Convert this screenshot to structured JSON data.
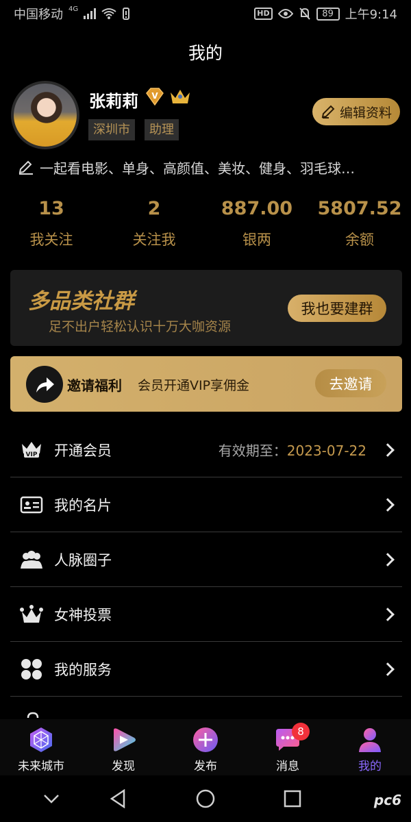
{
  "status_bar": {
    "carrier": "中国移动",
    "network": "4G",
    "hd": "HD",
    "battery": "89",
    "time": "上午9:14"
  },
  "header": {
    "title": "我的"
  },
  "profile": {
    "name": "张莉莉",
    "vip_badge": "V",
    "tags": [
      "深圳市",
      "助理"
    ],
    "edit_label": "编辑资料",
    "bio": "一起看电影、单身、高颜值、美妆、健身、羽毛球…"
  },
  "stats": [
    {
      "value": "13",
      "label": "我关注"
    },
    {
      "value": "2",
      "label": "关注我"
    },
    {
      "value": "887.00",
      "label": "银两"
    },
    {
      "value": "5807.52",
      "label": "余额"
    }
  ],
  "community": {
    "title": "多品类社群",
    "subtitle": "足不出户轻松认识十万大咖资源",
    "button": "我也要建群"
  },
  "invite": {
    "title": "邀请福利",
    "desc": "会员开通VIP享佣金",
    "button": "去邀请"
  },
  "menu": [
    {
      "label": "开通会员",
      "icon": "vip-crown-icon",
      "right_key": "有效期至：",
      "right_value": "2023-07-22"
    },
    {
      "label": "我的名片",
      "icon": "id-card-icon"
    },
    {
      "label": "人脉圈子",
      "icon": "people-icon"
    },
    {
      "label": "女神投票",
      "icon": "crown-icon"
    },
    {
      "label": "我的服务",
      "icon": "grid-clover-icon"
    }
  ],
  "tabs": [
    {
      "label": "未来城市",
      "icon": "polyhedron-icon"
    },
    {
      "label": "发现",
      "icon": "play-icon"
    },
    {
      "label": "发布",
      "icon": "plus-circle-icon"
    },
    {
      "label": "消息",
      "icon": "chat-icon",
      "badge": "8"
    },
    {
      "label": "我的",
      "icon": "person-icon",
      "active": true
    }
  ],
  "watermark": "pc6"
}
